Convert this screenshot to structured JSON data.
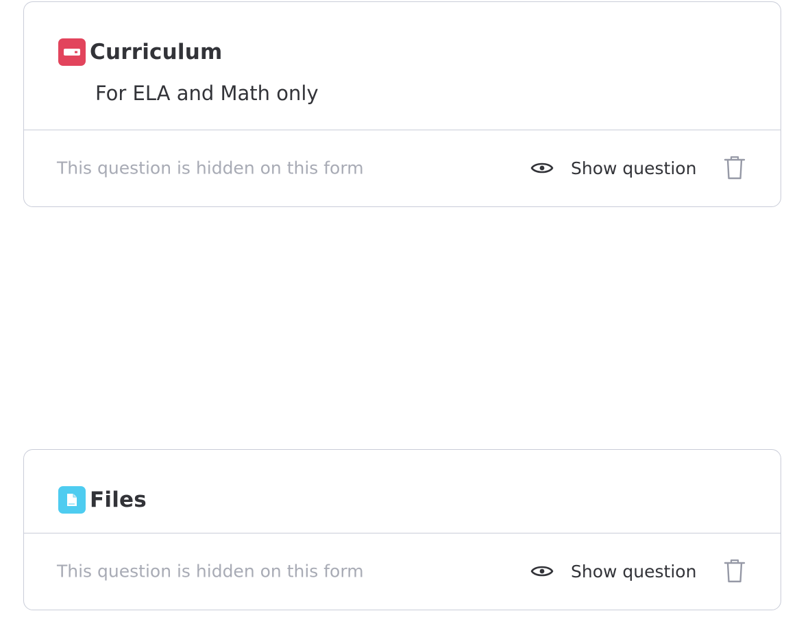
{
  "cards": [
    {
      "title": "Curriculum",
      "description": "For ELA and Math only",
      "icon": "text-column-icon",
      "icon_color": "#e2445c",
      "hidden_note": "This question is hidden on this form",
      "show_label": "Show question"
    },
    {
      "title": "Files",
      "icon": "file-column-icon",
      "icon_color": "#4eccf0",
      "hidden_note": "This question is hidden on this form",
      "show_label": "Show question"
    }
  ]
}
